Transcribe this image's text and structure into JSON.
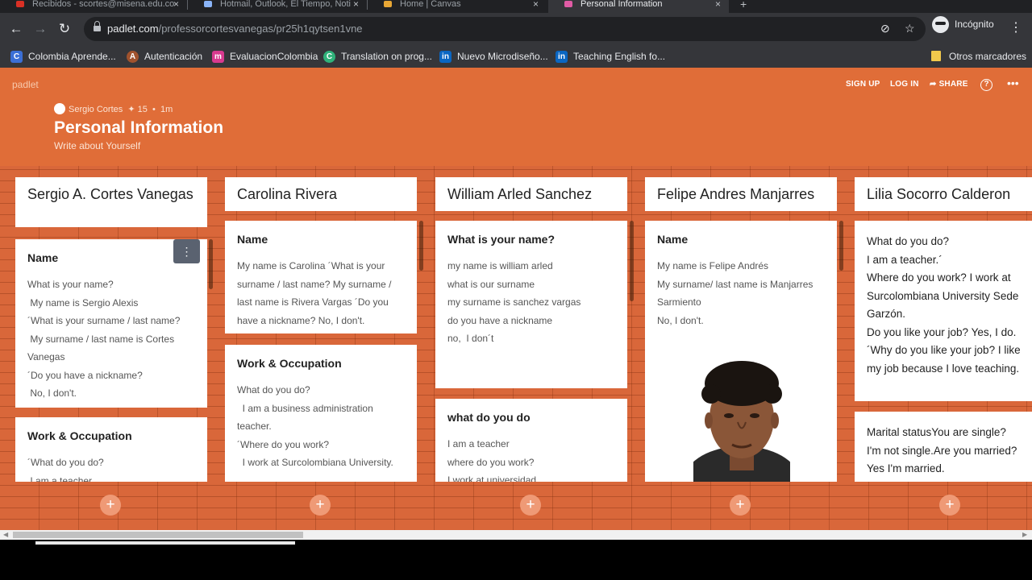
{
  "browser": {
    "tabs": [
      {
        "label": "Recibidos - scortes@misena.edu.co",
        "active": false
      },
      {
        "label": "Hotmail, Outlook, El Tiempo, Noti",
        "active": false
      },
      {
        "label": "Home | Canvas",
        "active": false
      },
      {
        "label": "Personal Information",
        "active": true
      }
    ],
    "url_host": "padlet.com",
    "url_path": "/professorcortesvanegas/pr25h1qytsen1vne",
    "profile_label": "Incógnito",
    "bookmarks": [
      {
        "label": "Colombia Aprende...",
        "color": "#3b6fd6",
        "glyph": "C"
      },
      {
        "label": "Autenticación",
        "color": "#a0522d",
        "glyph": "A"
      },
      {
        "label": "EvaluacionColombia",
        "color": "#d83a8f",
        "glyph": "m"
      },
      {
        "label": "Translation on prog...",
        "color": "#2fb27a",
        "glyph": "C"
      },
      {
        "label": "Nuevo Microdiseño...",
        "color": "#0a66c2",
        "glyph": "in"
      },
      {
        "label": "Teaching English fo...",
        "color": "#0a66c2",
        "glyph": "in"
      }
    ],
    "other_bookmarks": "Otros marcadores"
  },
  "padlet": {
    "brand": "padlet",
    "signup": "SIGN UP",
    "login": "LOG IN",
    "share": "SHARE",
    "author": "Sergio Cortes",
    "likes": "15",
    "time": "1m",
    "title": "Personal Information",
    "subtitle": "Write about Yourself"
  },
  "columns": [
    {
      "header": "Sergio A. Cortes Vanegas",
      "posts": [
        {
          "title": "Name",
          "body": "What is your name?\n My name is Sergio Alexis\n´What is your surname / last name?\n My surname / last name is Cortes Vanegas\n´Do you have a nickname?\n No, I don't."
        },
        {
          "title": "Work & Occupation",
          "body": "´What do you do?\n I am a teacher."
        }
      ]
    },
    {
      "header": "Carolina Rivera",
      "posts": [
        {
          "title": "Name",
          "body": "My name is Carolina ´What is your surname / last name? My surname / last name is Rivera Vargas ´Do you have a nickname? No, I don't."
        },
        {
          "title": "Work & Occupation",
          "body": "What do you do?\n  I am a business administration teacher.\n´Where do you work?\n  I work at Surcolombiana University."
        }
      ]
    },
    {
      "header": "William Arled Sanchez",
      "posts": [
        {
          "title": "What is your name?",
          "body": "my name is william arled\nwhat is our surname\nmy surname is sanchez vargas\ndo you have a nickname\nno,  I don´t"
        },
        {
          "title": "what do you do",
          "body": "I am a teacher\nwhere do you work?\nI work at universidad"
        }
      ]
    },
    {
      "header": "Felipe Andres Manjarres",
      "posts": [
        {
          "title": "Name",
          "body": "My name is Felipe Andrés\nMy surname/ last name is Manjarres Sarmiento\nNo, I don't."
        }
      ]
    },
    {
      "header": "Lilia Socorro Calderon",
      "posts": [
        {
          "title": "",
          "body": "What do you do?\nI am a teacher.´\nWhere do you work? I work at Surcolombiana University Sede Garzón.\nDo you like your job? Yes, I do.\n´Why do you like your job? I like my job because I love teaching."
        },
        {
          "title": "",
          "body": "Marital statusYou are single?\nI'm not single.Are you married?\nYes I'm married."
        }
      ]
    }
  ]
}
